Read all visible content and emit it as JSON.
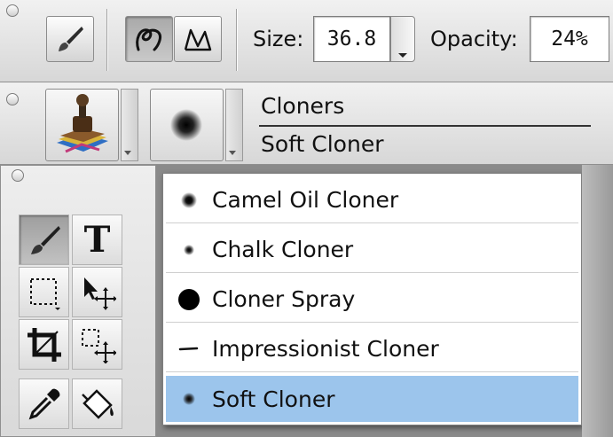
{
  "toolbar": {
    "size_label": "Size:",
    "size_value": "36.8",
    "opacity_label": "Opacity:",
    "opacity_value": "24%"
  },
  "brush_selector": {
    "category": "Cloners",
    "variant": "Soft Cloner"
  },
  "variant_menu": {
    "items": [
      {
        "label": "Camel Oil Cloner",
        "icon": "soft-dot"
      },
      {
        "label": "Chalk Cloner",
        "icon": "small-dot"
      },
      {
        "label": "Cloner Spray",
        "icon": "solid-dot"
      },
      {
        "label": "Impressionist Cloner",
        "icon": "dash"
      },
      {
        "label": "Soft Cloner",
        "icon": "soft-dot",
        "selected": true
      }
    ]
  },
  "toolbox": {
    "tools": [
      "brush-tool",
      "text-tool",
      "rectangular-selection-tool",
      "layer-adjuster-tool",
      "crop-tool",
      "transform-tool",
      "dropper-tool",
      "paint-bucket-tool"
    ]
  },
  "colors": {
    "selection": "#9cc5ec",
    "panel": "#d9d9d9"
  }
}
